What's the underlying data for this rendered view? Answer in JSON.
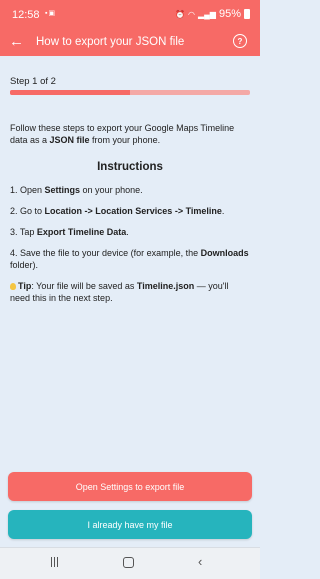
{
  "status_bar": {
    "time": "12:58",
    "left_icons": [
      "sim-icon",
      "gallery-icon"
    ],
    "right_icons": [
      "alarm-icon",
      "wifi-icon",
      "signal-icon"
    ],
    "battery": "95%"
  },
  "app_bar": {
    "title": "How to export your JSON file",
    "back_icon": "arrow-left-icon",
    "help_icon": "question-help-icon"
  },
  "progress": {
    "label": "Step 1 of 2",
    "value": 0.5,
    "fill_color": "#f76a66",
    "track_color": "#f4a9a6"
  },
  "content": {
    "intro_before": "Follow these steps to export your Google Maps Timeline data as a ",
    "intro_bold": "JSON file",
    "intro_after": " from your phone.",
    "heading": "Instructions",
    "steps": [
      {
        "a": "1. Open ",
        "b": "Settings",
        "c": " on your phone."
      },
      {
        "a": "2. Go to ",
        "b": "Location -> Location Services -> Timeline",
        "c": "."
      },
      {
        "a": "3. Tap ",
        "b": "Export Timeline Data",
        "c": "."
      },
      {
        "a": "4. Save the file to your device (for example, the ",
        "b": "Downloads",
        "c": " folder)."
      }
    ],
    "tip": {
      "label": "Tip",
      "text_before": ": Your file will be saved as ",
      "filename": "Timeline.json",
      "text_after": " — you'll need this in the next step."
    }
  },
  "buttons": {
    "primary": "Open Settings to export file",
    "secondary": "I already have my file",
    "primary_color": "#f76a66",
    "secondary_color": "#26b4bd"
  },
  "nav_bar": {
    "recents_icon": "recents-icon",
    "home_icon": "home-icon",
    "back_icon": "nav-back-icon"
  }
}
